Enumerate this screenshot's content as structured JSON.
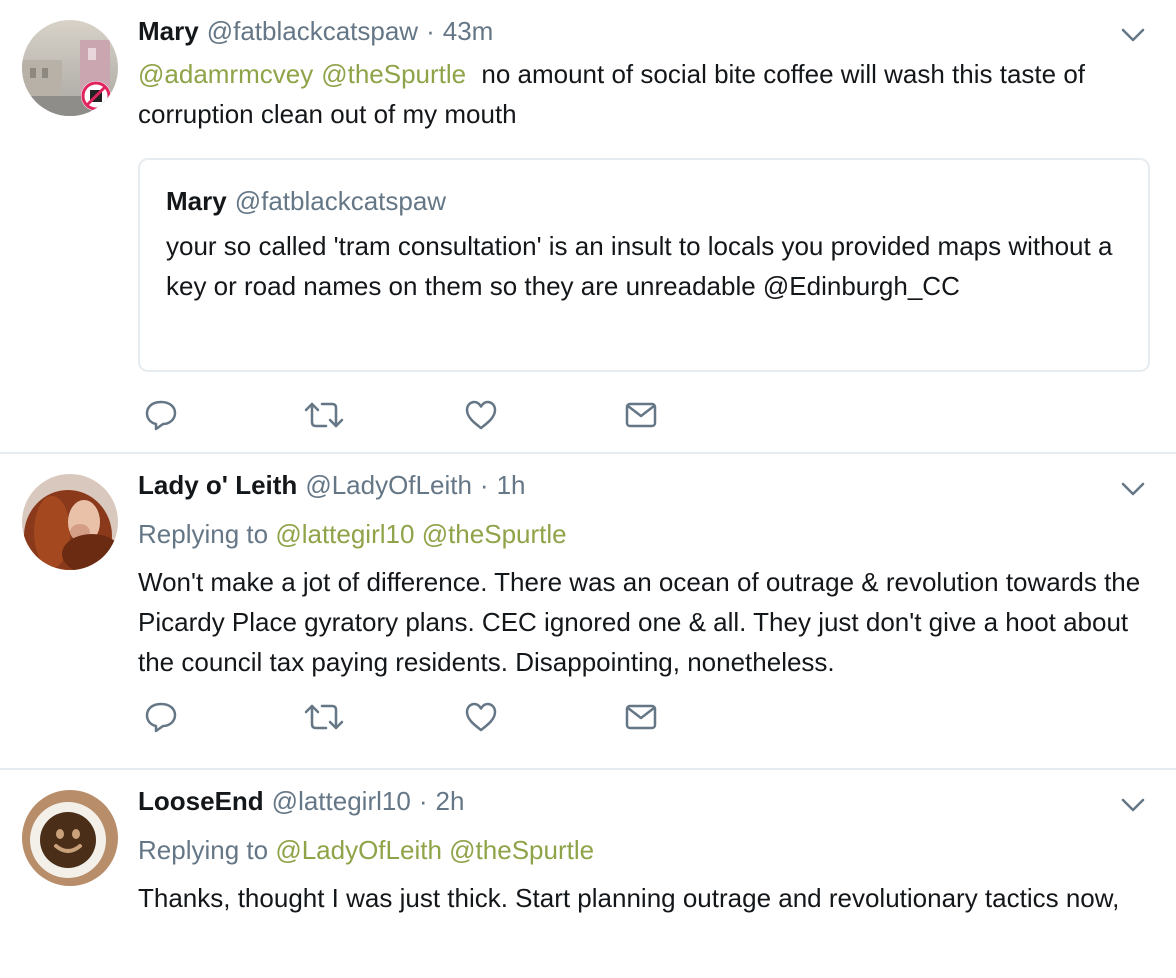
{
  "colors": {
    "link": "#8fa349",
    "secondary_text": "#657786",
    "primary_text": "#14171a",
    "divider": "#e6ecf0",
    "icon": "#657786"
  },
  "tweets": [
    {
      "name": "Mary",
      "handle": "@fatblackcatspaw",
      "separator": "·",
      "time": "43m",
      "mentions": [
        "@adamrmcvey",
        "@theSpurtle"
      ],
      "text": "no amount of social bite coffee will wash this taste of corruption clean out of my mouth",
      "quoted": {
        "name": "Mary",
        "handle": "@fatblackcatspaw",
        "text": "your so called 'tram consultation' is an insult to locals you provided maps without a key or road names on them so they are unreadable @Edinburgh_CC"
      },
      "actions": [
        "reply-icon",
        "retweet-icon",
        "like-icon",
        "message-icon"
      ]
    },
    {
      "name": "Lady o' Leith",
      "handle": "@LadyOfLeith",
      "separator": "·",
      "time": "1h",
      "replying_prefix": "Replying to",
      "replying_to": [
        "@lattegirl10",
        "@theSpurtle"
      ],
      "text": "Won't make a jot of difference. There was an ocean of outrage & revolution towards the Picardy Place gyratory plans. CEC ignored one & all. They just don't give a hoot about the council tax paying residents. Disappointing, nonetheless.",
      "actions": [
        "reply-icon",
        "retweet-icon",
        "like-icon",
        "message-icon"
      ]
    },
    {
      "name": "LooseEnd",
      "handle": "@lattegirl10",
      "separator": "·",
      "time": "2h",
      "replying_prefix": "Replying to",
      "replying_to": [
        "@LadyOfLeith",
        "@theSpurtle"
      ],
      "text": "Thanks, thought I was just thick. Start planning outrage and revolutionary tactics now,"
    }
  ]
}
